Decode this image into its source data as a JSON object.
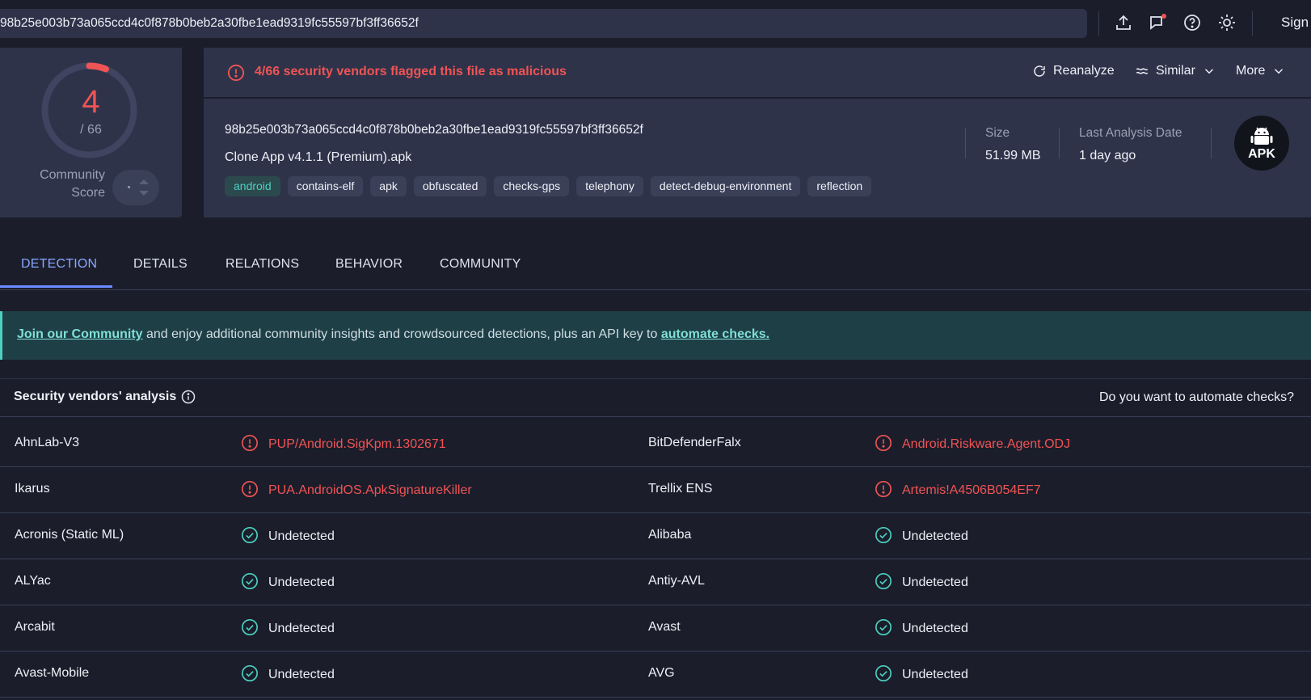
{
  "search": {
    "value": "98b25e003b73a065ccd4c0f878b0beb2a30fbe1ead9319fc55597bf3ff36652f"
  },
  "topbar": {
    "signin_label": "Sign",
    "icons": [
      "upload-icon",
      "chat-icon",
      "help-icon",
      "theme-icon"
    ],
    "notification_color": "#f05454"
  },
  "score": {
    "detections": "4",
    "total": "/ 66",
    "community_label": "Community Score",
    "fraction_flagged": 0.0606
  },
  "alert": {
    "text": "4/66 security vendors flagged this file as malicious",
    "color": "#f05454"
  },
  "actions": {
    "reanalyze": "Reanalyze",
    "similar": "Similar",
    "more": "More"
  },
  "file": {
    "hash": "98b25e003b73a065ccd4c0f878b0beb2a30fbe1ead9319fc55597bf3ff36652f",
    "name": "Clone App v4.1.1 (Premium).apk",
    "tags": [
      "android",
      "contains-elf",
      "apk",
      "obfuscated",
      "checks-gps",
      "telephony",
      "detect-debug-environment",
      "reflection"
    ],
    "size_label": "Size",
    "size_value": "51.99 MB",
    "last_label": "Last Analysis Date",
    "last_value": "1 day ago",
    "type_badge": "APK"
  },
  "tabs": [
    "DETECTION",
    "DETAILS",
    "RELATIONS",
    "BEHAVIOR",
    "COMMUNITY"
  ],
  "banner": {
    "link1": "Join our Community",
    "middle": " and enjoy additional community insights and crowdsourced detections, plus an API key to ",
    "link2": "automate checks."
  },
  "vendors_header": {
    "title": "Security vendors' analysis",
    "right": "Do you want to automate checks?"
  },
  "vendors": [
    {
      "left_name": "AhnLab-V3",
      "left_result": "PUP/Android.SigKpm.1302671",
      "left_status": "malicious",
      "right_name": "BitDefenderFalx",
      "right_result": "Android.Riskware.Agent.ODJ",
      "right_status": "malicious"
    },
    {
      "left_name": "Ikarus",
      "left_result": "PUA.AndroidOS.ApkSignatureKiller",
      "left_status": "malicious",
      "right_name": "Trellix ENS",
      "right_result": "Artemis!A4506B054EF7",
      "right_status": "malicious"
    },
    {
      "left_name": "Acronis (Static ML)",
      "left_result": "Undetected",
      "left_status": "clean",
      "right_name": "Alibaba",
      "right_result": "Undetected",
      "right_status": "clean"
    },
    {
      "left_name": "ALYac",
      "left_result": "Undetected",
      "left_status": "clean",
      "right_name": "Antiy-AVL",
      "right_result": "Undetected",
      "right_status": "clean"
    },
    {
      "left_name": "Arcabit",
      "left_result": "Undetected",
      "left_status": "clean",
      "right_name": "Avast",
      "right_result": "Undetected",
      "right_status": "clean"
    },
    {
      "left_name": "Avast-Mobile",
      "left_result": "Undetected",
      "left_status": "clean",
      "right_name": "AVG",
      "right_result": "Undetected",
      "right_status": "clean"
    }
  ]
}
